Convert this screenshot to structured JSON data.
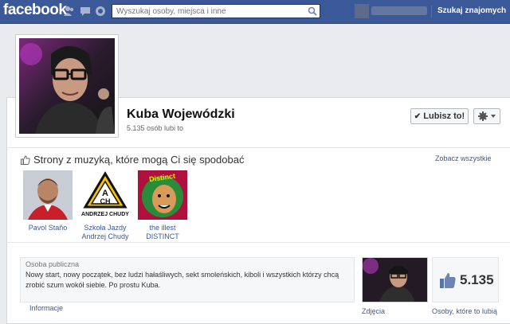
{
  "topbar": {
    "logo": "facebook",
    "search_placeholder": "Wyszukaj osoby, miejsca i inne",
    "find_friends": "Szukaj znajomych",
    "brand_color": "#3b5998"
  },
  "page": {
    "name": "Kuba Wojewódzki",
    "likes_line": "5.135 osób lubi to",
    "like_button": "Lubisz to!"
  },
  "recommendations": {
    "title": "Strony z muzyką, które mogą Ci się spodobać",
    "see_all": "Zobacz wszystkie",
    "items": [
      {
        "line1": "Pavol Staňo",
        "line2": ""
      },
      {
        "line1": "Szkoła Jazdy",
        "line2": "Andrzej Chudy",
        "logo_top": "A",
        "logo_bottom": "CH",
        "logo_caption": "ANDRZEJ CHUDY"
      },
      {
        "line1": "the illest",
        "line2": "DISTINCT",
        "logo_top": "Distinct"
      }
    ]
  },
  "about": {
    "category": "Osoba publiczna",
    "text": "Nowy start, nowy początek, bez ludzi hałaśliwych, sekt smoleńskich, kiboli i wszystkich którzy chcą zrobić szum wokół siebie. Po prostu Kuba.",
    "info_link": "Informacje"
  },
  "stats": {
    "photos_label": "Zdjęcia",
    "likes_number": "5.135",
    "likes_label": "Osoby, które to lubią"
  }
}
